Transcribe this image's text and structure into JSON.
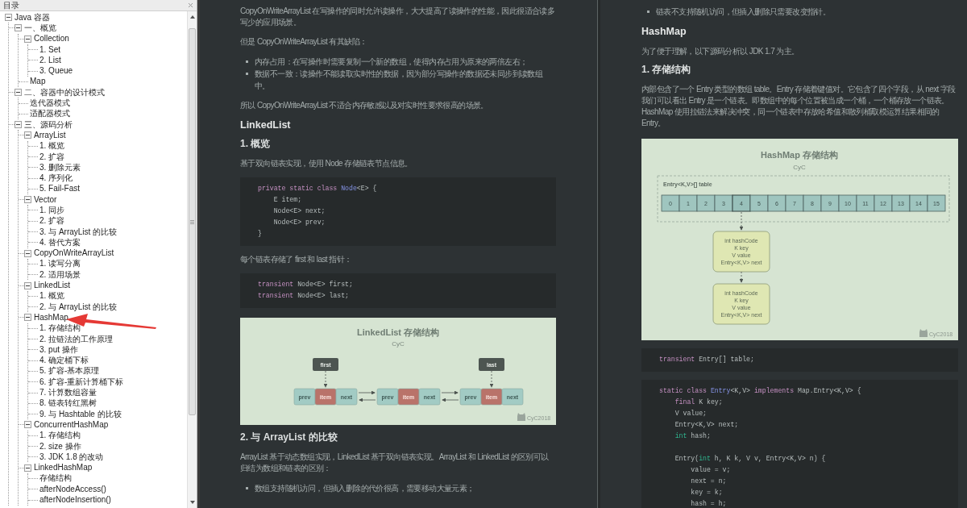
{
  "sidebar": {
    "title": "目录",
    "tree": [
      {
        "label": "Java 容器",
        "expanded": true,
        "children": [
          {
            "label": "一、概览",
            "expanded": true,
            "children": [
              {
                "label": "Collection",
                "expanded": true,
                "children": [
                  {
                    "label": "1. Set"
                  },
                  {
                    "label": "2. List"
                  },
                  {
                    "label": "3. Queue"
                  }
                ]
              },
              {
                "label": "Map"
              }
            ]
          },
          {
            "label": "二、容器中的设计模式",
            "expanded": true,
            "children": [
              {
                "label": "迭代器模式"
              },
              {
                "label": "适配器模式"
              }
            ]
          },
          {
            "label": "三、源码分析",
            "expanded": true,
            "children": [
              {
                "label": "ArrayList",
                "expanded": true,
                "children": [
                  {
                    "label": "1. 概览"
                  },
                  {
                    "label": "2. 扩容"
                  },
                  {
                    "label": "3. 删除元素"
                  },
                  {
                    "label": "4. 序列化"
                  },
                  {
                    "label": "5. Fail-Fast"
                  }
                ]
              },
              {
                "label": "Vector",
                "expanded": true,
                "children": [
                  {
                    "label": "1. 同步"
                  },
                  {
                    "label": "2. 扩容"
                  },
                  {
                    "label": "3. 与 ArrayList 的比较"
                  },
                  {
                    "label": "4. 替代方案"
                  }
                ]
              },
              {
                "label": "CopyOnWriteArrayList",
                "expanded": true,
                "children": [
                  {
                    "label": "1. 读写分离"
                  },
                  {
                    "label": "2. 适用场景"
                  }
                ]
              },
              {
                "label": "LinkedList",
                "expanded": true,
                "children": [
                  {
                    "label": "1. 概览"
                  },
                  {
                    "label": "2. 与 ArrayList 的比较"
                  }
                ]
              },
              {
                "label": "HashMap",
                "expanded": true,
                "children": [
                  {
                    "label": "1. 存储结构"
                  },
                  {
                    "label": "2. 拉链法的工作原理"
                  },
                  {
                    "label": "3. put 操作"
                  },
                  {
                    "label": "4. 确定桶下标"
                  },
                  {
                    "label": "5. 扩容-基本原理"
                  },
                  {
                    "label": "6. 扩容-重新计算桶下标"
                  },
                  {
                    "label": "7. 计算数组容量"
                  },
                  {
                    "label": "8. 链表转红黑树"
                  },
                  {
                    "label": "9. 与 Hashtable 的比较"
                  }
                ]
              },
              {
                "label": "ConcurrentHashMap",
                "expanded": true,
                "children": [
                  {
                    "label": "1. 存储结构"
                  },
                  {
                    "label": "2. size 操作"
                  },
                  {
                    "label": "3. JDK 1.8 的改动"
                  }
                ]
              },
              {
                "label": "LinkedHashMap",
                "expanded": true,
                "children": [
                  {
                    "label": "存储结构"
                  },
                  {
                    "label": "afterNodeAccess()"
                  },
                  {
                    "label": "afterNodeInsertion()"
                  }
                ]
              }
            ]
          }
        ]
      }
    ]
  },
  "columns": [
    {
      "blocks": [
        {
          "kind": "paragraph",
          "text": "CopyOnWriteArrayList 在写操作的同时允许读操作，大大提高了读操作的性能，因此很适合读多写少的应用场景。"
        },
        {
          "kind": "paragraph",
          "text": "但是 CopyOnWriteArrayList 有其缺陷："
        },
        {
          "kind": "list",
          "items": [
            "内存占用：在写操作时需要复制一个新的数组，使得内存占用为原来的两倍左右；",
            "数据不一致：读操作不能读取实时性的数据，因为部分写操作的数据还未同步到读数组中。"
          ]
        },
        {
          "kind": "paragraph",
          "text": "所以 CopyOnWriteArrayList 不适合内存敏感以及对实时性要求很高的场景。"
        },
        {
          "kind": "heading",
          "text": "LinkedList"
        },
        {
          "kind": "subheading",
          "text": "1. 概览"
        },
        {
          "kind": "paragraph",
          "text": "基于双向链表实现，使用 Node 存储链表节点信息。"
        },
        {
          "kind": "code",
          "lines": [
            {
              "kind": "code",
              "tokens": [
                {
                  "text": "private static class ",
                  "kind": "kw"
                },
                {
                  "text": "Node",
                  "kind": "type"
                },
                {
                  "text": "<E> {",
                  "kind": "plain"
                }
              ]
            },
            {
              "kind": "code",
              "tokens": [
                {
                  "text": "    E item;",
                  "kind": "plain"
                }
              ]
            },
            {
              "kind": "code",
              "tokens": [
                {
                  "text": "    Node<E> next;",
                  "kind": "plain"
                }
              ]
            },
            {
              "kind": "code",
              "tokens": [
                {
                  "text": "    Node<E> prev;",
                  "kind": "plain"
                }
              ]
            },
            {
              "kind": "code",
              "tokens": [
                {
                  "text": "}",
                  "kind": "plain"
                }
              ]
            }
          ]
        },
        {
          "kind": "paragraph",
          "text": "每个链表存储了 first 和 last 指针："
        },
        {
          "kind": "code",
          "lines": [
            {
              "kind": "code",
              "tokens": [
                {
                  "text": "transient",
                  "kind": "kw"
                },
                {
                  "text": " Node<E> first;",
                  "kind": "plain"
                }
              ]
            },
            {
              "kind": "code",
              "tokens": [
                {
                  "text": "transient",
                  "kind": "kw"
                },
                {
                  "text": " Node<E> last;",
                  "kind": "plain"
                }
              ]
            }
          ]
        },
        {
          "kind": "linkedlist_figure",
          "title": "LinkedList 存储结构",
          "subtitle": "CyC",
          "credit": "CyC2018",
          "nodes": [
            {
              "pointer": "first",
              "fields": [
                {
                  "text": "prev",
                  "kind": "link"
                },
                {
                  "text": "item",
                  "kind": "value"
                },
                {
                  "text": "next",
                  "kind": "link"
                }
              ]
            },
            {
              "fields": [
                {
                  "text": "prev",
                  "kind": "link"
                },
                {
                  "text": "item",
                  "kind": "value"
                },
                {
                  "text": "next",
                  "kind": "link"
                }
              ]
            },
            {
              "pointer": "last",
              "fields": [
                {
                  "text": "prev",
                  "kind": "link"
                },
                {
                  "text": "item",
                  "kind": "value"
                },
                {
                  "text": "next",
                  "kind": "link"
                }
              ]
            }
          ]
        },
        {
          "kind": "subheading",
          "text": "2. 与 ArrayList 的比较"
        },
        {
          "kind": "paragraph",
          "text": "ArrayList 基于动态数组实现，LinkedList 基于双向链表实现。ArrayList 和 LinkedList 的区别可以归结为数组和链表的区别："
        },
        {
          "kind": "list",
          "items": [
            "数组支持随机访问，但插入删除的代价很高，需要移动大量元素；"
          ]
        }
      ]
    },
    {
      "blocks": [
        {
          "kind": "list",
          "items": [
            "链表不支持随机访问，但插入删除只需要改变指针。"
          ]
        },
        {
          "kind": "heading",
          "text": "HashMap"
        },
        {
          "kind": "paragraph",
          "text": "为了便于理解，以下源码分析以 JDK 1.7 为主。"
        },
        {
          "kind": "subheading",
          "text": "1. 存储结构"
        },
        {
          "kind": "paragraph",
          "text": "内部包含了一个 Entry 类型的数组 table。Entry 存储着键值对。它包含了四个字段，从 next 字段我们可以看出 Entry 是一个链表。即数组中的每个位置被当成一个桶，一个桶存放一个链表。HashMap 使用拉链法来解决冲突，同一个链表中存放哈希值和散列桶取模运算结果相同的 Entry。"
        },
        {
          "kind": "hashmap_figure",
          "title": "HashMap 存储结构",
          "subtitle": "CyC",
          "table_label": "Entry<K,V>[] table",
          "credit": "CyC2018",
          "cells": [
            {
              "label": "0",
              "linked": false
            },
            {
              "label": "1",
              "linked": false
            },
            {
              "label": "2",
              "linked": false
            },
            {
              "label": "3",
              "linked": false
            },
            {
              "label": "4",
              "linked": true
            },
            {
              "label": "5",
              "linked": false
            },
            {
              "label": "6",
              "linked": false
            },
            {
              "label": "7",
              "linked": false
            },
            {
              "label": "8",
              "linked": false
            },
            {
              "label": "9",
              "linked": false
            },
            {
              "label": "10",
              "linked": false
            },
            {
              "label": "11",
              "linked": false
            },
            {
              "label": "12",
              "linked": false
            },
            {
              "label": "13",
              "linked": false
            },
            {
              "label": "14",
              "linked": false
            },
            {
              "label": "15",
              "linked": false
            }
          ],
          "entries": [
            {
              "lines": [
                "int hashCode",
                "K key",
                "V value",
                "Entry<K,V> next"
              ]
            },
            {
              "lines": [
                "int hashCode",
                "K key",
                "V value",
                "Entry<K,V> next"
              ]
            }
          ]
        },
        {
          "kind": "code",
          "lines": [
            {
              "kind": "code",
              "tokens": [
                {
                  "text": "transient",
                  "kind": "kw"
                },
                {
                  "text": " Entry[] table;",
                  "kind": "plain"
                }
              ]
            }
          ]
        },
        {
          "kind": "code",
          "lines": [
            {
              "kind": "code",
              "tokens": [
                {
                  "text": "static class ",
                  "kind": "kw"
                },
                {
                  "text": "Entry",
                  "kind": "type"
                },
                {
                  "text": "<K,V> ",
                  "kind": "plain"
                },
                {
                  "text": "implements",
                  "kind": "kw"
                },
                {
                  "text": " Map.Entry<K,V> {",
                  "kind": "plain"
                }
              ]
            },
            {
              "kind": "code",
              "tokens": [
                {
                  "text": "    final",
                  "kind": "kw"
                },
                {
                  "text": " K key;",
                  "kind": "plain"
                }
              ]
            },
            {
              "kind": "code",
              "tokens": [
                {
                  "text": "    V value;",
                  "kind": "plain"
                }
              ]
            },
            {
              "kind": "code",
              "tokens": [
                {
                  "text": "    Entry<K,V> next;",
                  "kind": "plain"
                }
              ]
            },
            {
              "kind": "code",
              "tokens": [
                {
                  "text": "    int",
                  "kind": "prim"
                },
                {
                  "text": " hash;",
                  "kind": "plain"
                }
              ]
            },
            {
              "kind": "blank"
            },
            {
              "kind": "code",
              "tokens": [
                {
                  "text": "    Entry(",
                  "kind": "plain"
                },
                {
                  "text": "int",
                  "kind": "prim"
                },
                {
                  "text": " h, K k, V v, Entry<K,V> n) {",
                  "kind": "plain"
                }
              ]
            },
            {
              "kind": "code",
              "tokens": [
                {
                  "text": "        value = v;",
                  "kind": "plain"
                }
              ]
            },
            {
              "kind": "code",
              "tokens": [
                {
                  "text": "        next = n;",
                  "kind": "plain"
                }
              ]
            },
            {
              "kind": "code",
              "tokens": [
                {
                  "text": "        key = k;",
                  "kind": "plain"
                }
              ]
            },
            {
              "kind": "code",
              "tokens": [
                {
                  "text": "        hash = h;",
                  "kind": "plain"
                }
              ]
            }
          ]
        }
      ]
    }
  ]
}
